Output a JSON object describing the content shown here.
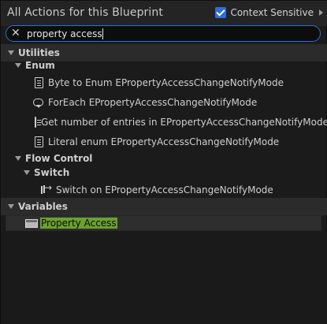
{
  "window": {
    "title": "All Actions for this Blueprint",
    "context_sensitive_label": "Context Sensitive",
    "context_sensitive_checked": true
  },
  "search": {
    "value": "property access",
    "clear_icon": "close-icon"
  },
  "tree": {
    "utilities": "Utilities",
    "enum": "Enum",
    "enum_items": [
      {
        "label": "Byte to Enum EPropertyAccessChangeNotifyMode",
        "icon": "function-icon"
      },
      {
        "label": "ForEach EPropertyAccessChangeNotifyMode",
        "icon": "loop-icon"
      },
      {
        "label": "Get number of entries in EPropertyAccessChangeNotifyMode",
        "icon": "function-icon"
      },
      {
        "label": "Literal enum EPropertyAccessChangeNotifyMode",
        "icon": "function-icon"
      }
    ],
    "flow_control": "Flow Control",
    "switch": "Switch",
    "switch_items": [
      {
        "label": "Switch on EPropertyAccessChangeNotifyMode",
        "icon": "switch-icon"
      }
    ],
    "variables": "Variables",
    "variable_items": [
      {
        "label": "Property Access",
        "icon": "variable-icon",
        "selected": true
      }
    ]
  },
  "colors": {
    "accent": "#2e6fd6",
    "highlight": "#6aa12f"
  }
}
